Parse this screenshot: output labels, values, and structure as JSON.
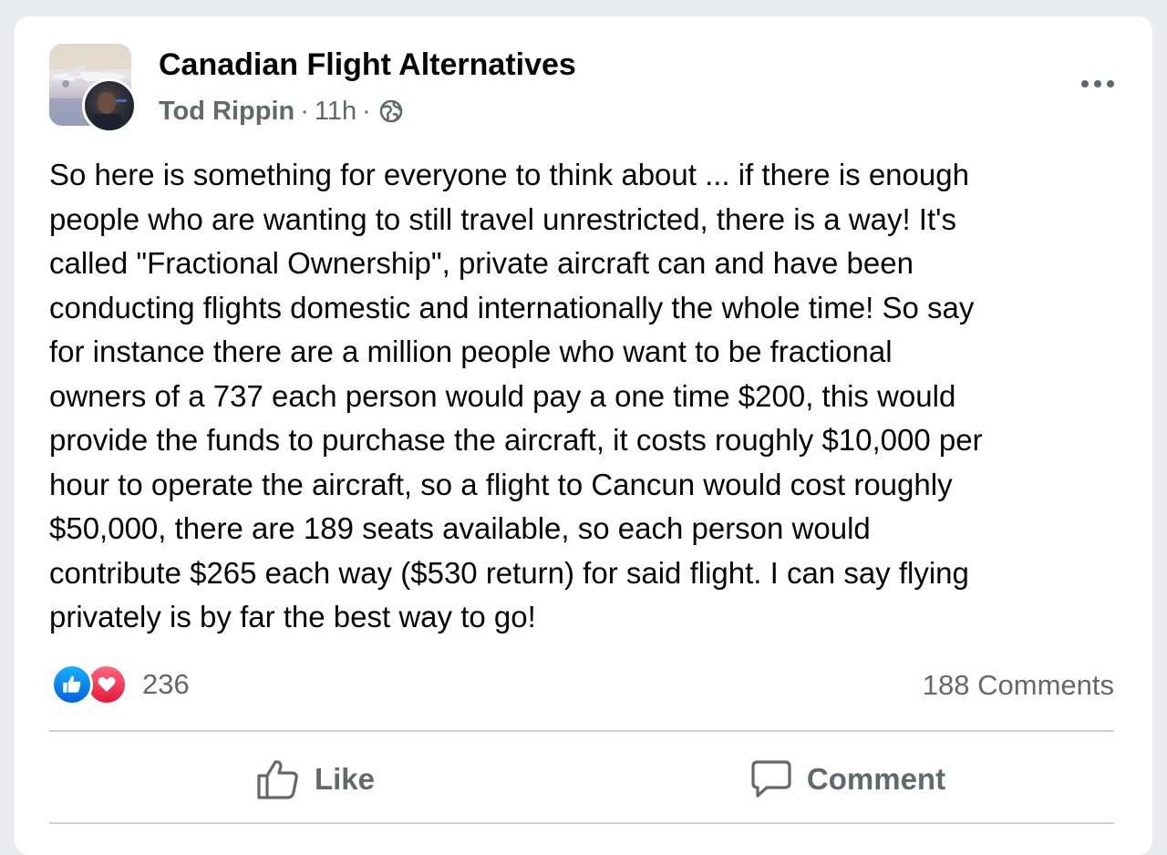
{
  "post": {
    "group_name": "Canadian Flight Alternatives",
    "author": "Tod Rippin",
    "separator": "·",
    "time": "11h",
    "text": "So here is something for everyone to think about ... if there is enough\npeople who are wanting to still travel unrestricted, there is a way! It's\ncalled \"Fractional Ownership\", private aircraft can and have been\nconducting flights domestic and internationally the whole time! So say\nfor instance there are a million people who want to be fractional\nowners of a 737 each person would pay a one time $200, this would\nprovide the funds to purchase the aircraft, it costs roughly $10,000 per\nhour to operate the aircraft, so a flight to Cancun would cost roughly\n$50,000, there are 189 seats available, so each person would\ncontribute $265 each way ($530 return) for said flight. I can say flying\nprivately is by far the best way to go!"
  },
  "stats": {
    "reaction_count": "236",
    "comments": "188 Comments"
  },
  "actions": {
    "like_label": "Like",
    "comment_label": "Comment"
  },
  "icons": {
    "privacy": "globe-icon",
    "more": "more-options-icon",
    "like": "thumbs-up-icon",
    "comment": "comment-bubble-icon"
  },
  "colors": {
    "secondary_text": "#65676b",
    "like_blue": "#1877f2",
    "love_red": "#f33e58"
  }
}
